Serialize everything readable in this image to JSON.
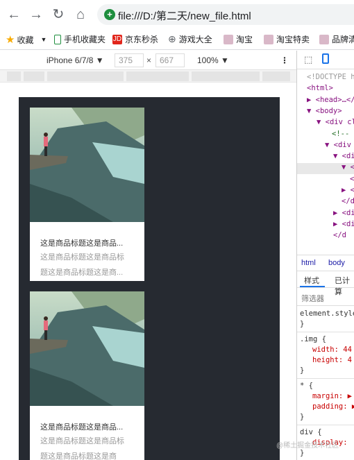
{
  "browser": {
    "url": "file:///D:/第二天/new_file.html"
  },
  "bookmarks": [
    {
      "label": "收藏",
      "icon": "star-icon",
      "color": "#f9ab00"
    },
    {
      "label": "手机收藏夹",
      "icon": "phone-icon",
      "color": "#1e8e3e"
    },
    {
      "label": "京东秒杀",
      "icon": "jd-icon",
      "color": "#e1251b",
      "icon_text": "JD"
    },
    {
      "label": "游戏大全",
      "icon": "globe-icon",
      "color": "#5f6368"
    },
    {
      "label": "淘宝",
      "icon": "taobao-icon",
      "color": "#c5a3b8"
    },
    {
      "label": "淘宝特卖",
      "icon": "taobao-icon",
      "color": "#c5a3b8"
    },
    {
      "label": "品牌清",
      "icon": "taobao-icon",
      "color": "#c5a3b8"
    }
  ],
  "device_toolbar": {
    "device": "iPhone 6/7/8 ▼",
    "width": "375",
    "times": "×",
    "height": "667",
    "zoom": "100% ▼"
  },
  "cards": [
    {
      "title": "这是商品标题这是商品...",
      "desc1": "这是商品标题这是商品标",
      "desc2": "题这是商品标题这是商..."
    },
    {
      "title": "这是商品标题这是商品...",
      "desc1": "这是商品标题这是商品标",
      "desc2": "题这是商品标题这是商"
    }
  ],
  "devtools": {
    "dom": [
      {
        "text": "<!DOCTYPE h",
        "indent": 14
      },
      {
        "text": "<html>",
        "indent": 14
      },
      {
        "text": "▶ <head>…</",
        "indent": 14
      },
      {
        "text": "▼ <body>",
        "indent": 14
      },
      {
        "text": "▼ <div cl",
        "indent": 28
      },
      {
        "text": "<!--",
        "indent": 50
      },
      {
        "text": "▼ <div",
        "indent": 40
      },
      {
        "text": "▼ <di",
        "indent": 52
      },
      {
        "text": "▼ <",
        "indent": 64,
        "selected": true
      },
      {
        "text": "</",
        "indent": 76
      },
      {
        "text": "▶ <",
        "indent": 64
      },
      {
        "text": "</d",
        "indent": 64
      },
      {
        "text": "▶ <di",
        "indent": 52
      },
      {
        "text": "▶ <di",
        "indent": 52
      },
      {
        "text": "</d",
        "indent": 52
      }
    ],
    "breadcrumb": [
      "html",
      "body"
    ],
    "tabs": [
      "样式",
      "已计算"
    ],
    "filter_placeholder": "筛选器",
    "styles": [
      {
        "text": "element.style",
        "kind": "selector"
      },
      {
        "text": "}",
        "kind": "brace"
      },
      {
        "text": ".img {",
        "kind": "selector"
      },
      {
        "text": "width: 44",
        "kind": "prop"
      },
      {
        "text": "height: 4",
        "kind": "prop"
      },
      {
        "text": "}",
        "kind": "brace"
      },
      {
        "text": "* {",
        "kind": "selector"
      },
      {
        "text": "margin: ▶",
        "kind": "prop"
      },
      {
        "text": "padding: ▶",
        "kind": "prop"
      },
      {
        "text": "}",
        "kind": "brace"
      },
      {
        "text": "div {",
        "kind": "selector"
      },
      {
        "text": "display:",
        "kind": "prop"
      },
      {
        "text": "}",
        "kind": "brace"
      }
    ]
  },
  "watermark": "@稀土掘金技术社区"
}
